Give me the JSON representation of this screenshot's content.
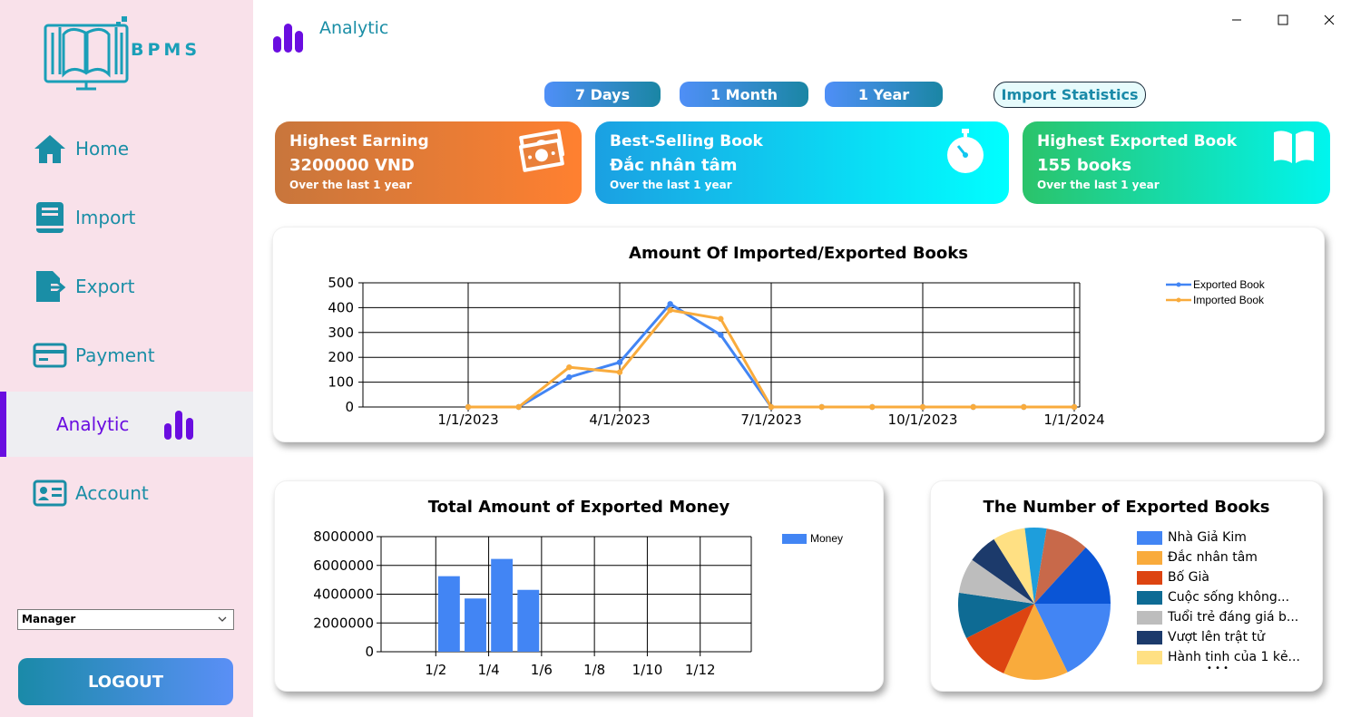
{
  "app": {
    "logo_text": "BPMS"
  },
  "sidebar": {
    "items": [
      {
        "label": "Home",
        "icon": "home-icon"
      },
      {
        "label": "Import",
        "icon": "book-icon"
      },
      {
        "label": "Export",
        "icon": "export-file-icon"
      },
      {
        "label": "Payment",
        "icon": "credit-card-icon"
      },
      {
        "label": "Analytic",
        "icon": "bar-chart-icon",
        "active": true
      },
      {
        "label": "Account",
        "icon": "id-card-icon"
      }
    ],
    "role_select": {
      "value": "Manager"
    },
    "logout_label": "LOGOUT"
  },
  "header": {
    "title": "Analytic"
  },
  "filters": {
    "days7": "7 Days",
    "month1": "1 Month",
    "year1": "1 Year",
    "import_stats": "Import Statistics"
  },
  "cards": [
    {
      "title": "Highest Earning",
      "value": "3200000 VND",
      "sub": "Over the last 1 year",
      "icon": "money-icon"
    },
    {
      "title": "Best-Selling Book",
      "value": "Đắc nhân tâm",
      "sub": "Over the last 1 year",
      "icon": "stopwatch-icon"
    },
    {
      "title": "Highest Exported Book",
      "value": "155 books",
      "sub": "Over the last 1 year",
      "icon": "open-book-icon"
    }
  ],
  "colors": {
    "sidebar_bg": "#f9e1ea",
    "accent": "#6a0de0",
    "teal": "#1a8ea6",
    "exported": "#4285f4",
    "imported": "#f9ab3c"
  },
  "chart_data": [
    {
      "type": "line",
      "title": "Amount Of Imported/Exported Books",
      "x_tick_labels": [
        "1/1/2023",
        "4/1/2023",
        "7/1/2023",
        "10/1/2023",
        "1/1/2024"
      ],
      "x": [
        "2023-01-01",
        "2023-02-01",
        "2023-03-01",
        "2023-04-01",
        "2023-05-01",
        "2023-06-01",
        "2023-07-01",
        "2023-08-01",
        "2023-09-01",
        "2023-10-01",
        "2023-11-01",
        "2023-12-01",
        "2024-01-01"
      ],
      "ylim": [
        0,
        500
      ],
      "y_ticks": [
        0,
        100,
        200,
        300,
        400,
        500
      ],
      "series": [
        {
          "name": "Exported Book",
          "values": [
            0,
            0,
            120,
            180,
            415,
            290,
            0,
            0,
            0,
            0,
            0,
            0,
            0
          ]
        },
        {
          "name": "Imported Book",
          "values": [
            0,
            0,
            160,
            140,
            390,
            355,
            0,
            0,
            0,
            0,
            0,
            0,
            0
          ]
        }
      ],
      "legend": "top-right",
      "grid": true
    },
    {
      "type": "bar",
      "title": "Total Amount of Exported Money",
      "x_tick_labels": [
        "1/2",
        "1/4",
        "1/6",
        "1/8",
        "1/10",
        "1/12"
      ],
      "categories": [
        "3",
        "4",
        "5",
        "6"
      ],
      "series": [
        {
          "name": "Money",
          "values": [
            5250000,
            3700000,
            6450000,
            4300000
          ]
        }
      ],
      "ylim": [
        0,
        8000000
      ],
      "y_ticks": [
        0,
        2000000,
        4000000,
        6000000,
        8000000
      ],
      "legend": "top-right",
      "grid": true
    },
    {
      "type": "pie",
      "title": "The Number of Exported Books",
      "legend_labels": [
        "Nhà Giả Kim",
        "Đắc nhân tâm",
        "Bố Già",
        "Cuộc sống không...",
        "Tuổi trẻ đáng giá b...",
        "Vượt lên trật tử",
        "Hành tinh của 1 kẻ..."
      ],
      "legend_more": "• • •",
      "slices": [
        {
          "value": 155,
          "color": "#4285f4"
        },
        {
          "value": 120,
          "color": "#f9ab3c"
        },
        {
          "value": 95,
          "color": "#dd4411"
        },
        {
          "value": 85,
          "color": "#0e6b94"
        },
        {
          "value": 65,
          "color": "#bdbdbd"
        },
        {
          "value": 55,
          "color": "#1c3a6b"
        },
        {
          "value": 60,
          "color": "#ffe083"
        },
        {
          "value": 40,
          "color": "#1e9edc"
        },
        {
          "value": 80,
          "color": "#c8694a"
        },
        {
          "value": 115,
          "color": "#0a55d6"
        }
      ],
      "legend": "right"
    }
  ]
}
